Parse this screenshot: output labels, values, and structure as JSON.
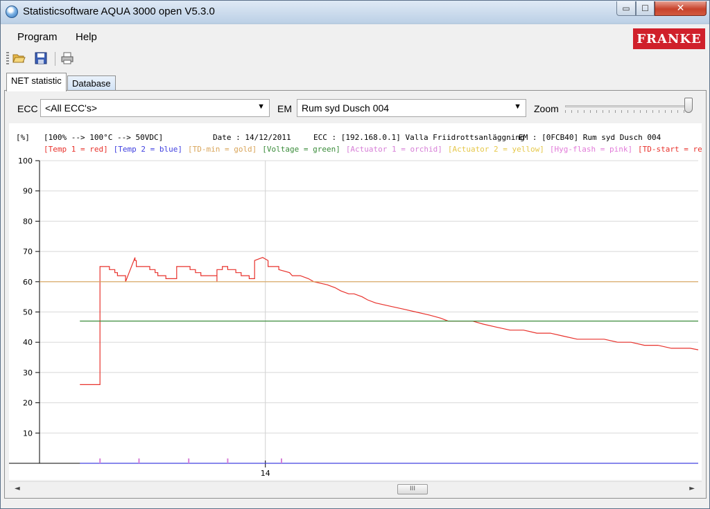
{
  "window": {
    "title": "Statisticsoftware AQUA 3000 open  V5.3.0",
    "min_glyph": "▭",
    "max_glyph": "☐",
    "close_glyph": "✕"
  },
  "menu": {
    "program": "Program",
    "help": "Help"
  },
  "logo": {
    "text": "FRANKE",
    "color": "#d0202b"
  },
  "toolbar": {
    "icons": [
      "open-folder-icon",
      "save-disk-icon",
      "print-icon"
    ]
  },
  "tabs": [
    {
      "label": "NET statistic",
      "selected": true
    },
    {
      "label": "Database",
      "selected": false
    }
  ],
  "filters": {
    "ecc_label": "ECC",
    "ecc_value": "<All ECC's>",
    "em_label": "EM",
    "em_value": "Rum syd Dusch 004",
    "zoom_label": "Zoom",
    "zoom_level": 1.0
  },
  "chart_header": {
    "unit": "[%]",
    "scale": "[100% --> 100°C --> 50VDC]",
    "date": "Date : 14/12/2011",
    "ecc": "ECC : [192.168.0.1]  Valla Friidrottsanläggning",
    "em": "EM : [0FCB40]  Rum syd Dusch 004"
  },
  "legend": [
    {
      "text": "[Temp 1 = red]",
      "color": "#e8312b"
    },
    {
      "text": "[Temp 2 = blue]",
      "color": "#4040e0"
    },
    {
      "text": "[TD-min = gold]",
      "color": "#d9a55a"
    },
    {
      "text": "[Voltage = green]",
      "color": "#3a8c3a"
    },
    {
      "text": "[Actuator 1 = orchid]",
      "color": "#d77fd7"
    },
    {
      "text": "[Actuator 2 = yellow]",
      "color": "#e6c84a"
    },
    {
      "text": "[Hyg-flash = pink]",
      "color": "#e27ad9"
    },
    {
      "text": "[TD-start = red]",
      "color": "#e8312b"
    }
  ],
  "chart_data": {
    "type": "line",
    "ylim": [
      0,
      100
    ],
    "yticks": [
      10,
      20,
      30,
      40,
      50,
      60,
      70,
      80,
      90,
      100
    ],
    "xticks": [
      {
        "label": "14"
      }
    ],
    "grid": true,
    "series": [
      {
        "name": "Temp 1",
        "color": "#e8312b",
        "points": [
          [
            0,
            26
          ],
          [
            7.5,
            26
          ],
          [
            7.5,
            65
          ],
          [
            11,
            65
          ],
          [
            11,
            64
          ],
          [
            13,
            64
          ],
          [
            13,
            63
          ],
          [
            14,
            63
          ],
          [
            14,
            62
          ],
          [
            17,
            62
          ],
          [
            17,
            60
          ],
          [
            20.5,
            68
          ],
          [
            20.5,
            67
          ],
          [
            21,
            67
          ],
          [
            21,
            65
          ],
          [
            26,
            65
          ],
          [
            26,
            64
          ],
          [
            28,
            64
          ],
          [
            28,
            63
          ],
          [
            29,
            63
          ],
          [
            29,
            62
          ],
          [
            32,
            62
          ],
          [
            32,
            61
          ],
          [
            36,
            61
          ],
          [
            36,
            65
          ],
          [
            41,
            65
          ],
          [
            41,
            64
          ],
          [
            43,
            64
          ],
          [
            43,
            63
          ],
          [
            45,
            63
          ],
          [
            45,
            62
          ],
          [
            51,
            62
          ],
          [
            51,
            60
          ],
          [
            51,
            64
          ],
          [
            53,
            64
          ],
          [
            53,
            65
          ],
          [
            55,
            65
          ],
          [
            55,
            64
          ],
          [
            58,
            64
          ],
          [
            58,
            63
          ],
          [
            60,
            63
          ],
          [
            60,
            62
          ],
          [
            63,
            62
          ],
          [
            63,
            61
          ],
          [
            65,
            61
          ],
          [
            65,
            67
          ],
          [
            68,
            68
          ],
          [
            70,
            67
          ],
          [
            70,
            65
          ],
          [
            74,
            65
          ],
          [
            74,
            64
          ],
          [
            78,
            63
          ],
          [
            79,
            62
          ],
          [
            82,
            62
          ],
          [
            85,
            61
          ],
          [
            87,
            60
          ],
          [
            92,
            59
          ],
          [
            95,
            58
          ],
          [
            97,
            57
          ],
          [
            100,
            56
          ],
          [
            102,
            56
          ],
          [
            105,
            55
          ],
          [
            107,
            54
          ],
          [
            110,
            53
          ],
          [
            115,
            52
          ],
          [
            120,
            51
          ],
          [
            125,
            50
          ],
          [
            130,
            49
          ],
          [
            134,
            48
          ],
          [
            137,
            47
          ],
          [
            146,
            47
          ],
          [
            150,
            46
          ],
          [
            155,
            45
          ],
          [
            160,
            44
          ],
          [
            165,
            44
          ],
          [
            170,
            43
          ],
          [
            175,
            43
          ],
          [
            180,
            42
          ],
          [
            185,
            41
          ],
          [
            195,
            41
          ],
          [
            200,
            40
          ],
          [
            205,
            40
          ],
          [
            210,
            39
          ],
          [
            215,
            39
          ],
          [
            220,
            38
          ],
          [
            227,
            38
          ],
          [
            230,
            37.5
          ]
        ]
      },
      {
        "name": "TD-min",
        "color": "#d9a55a",
        "points": [
          [
            -15,
            60
          ],
          [
            230,
            60
          ]
        ]
      },
      {
        "name": "Voltage",
        "color": "#3a8c3a",
        "points": [
          [
            0,
            47
          ],
          [
            230,
            47
          ]
        ]
      },
      {
        "name": "Temp 2",
        "color": "#4040e0",
        "points": [
          [
            0,
            0
          ],
          [
            230,
            0
          ]
        ]
      },
      {
        "name": "Actuator 1",
        "color": "#d77fd7",
        "markers_x": [
          7.5,
          22,
          40.5,
          55,
          75
        ]
      }
    ],
    "x_domain": [
      -15,
      230
    ],
    "cursor_x": 69
  },
  "scrollbar": {
    "thumb_glyph": "III",
    "left_glyph": "◄",
    "right_glyph": "►"
  }
}
